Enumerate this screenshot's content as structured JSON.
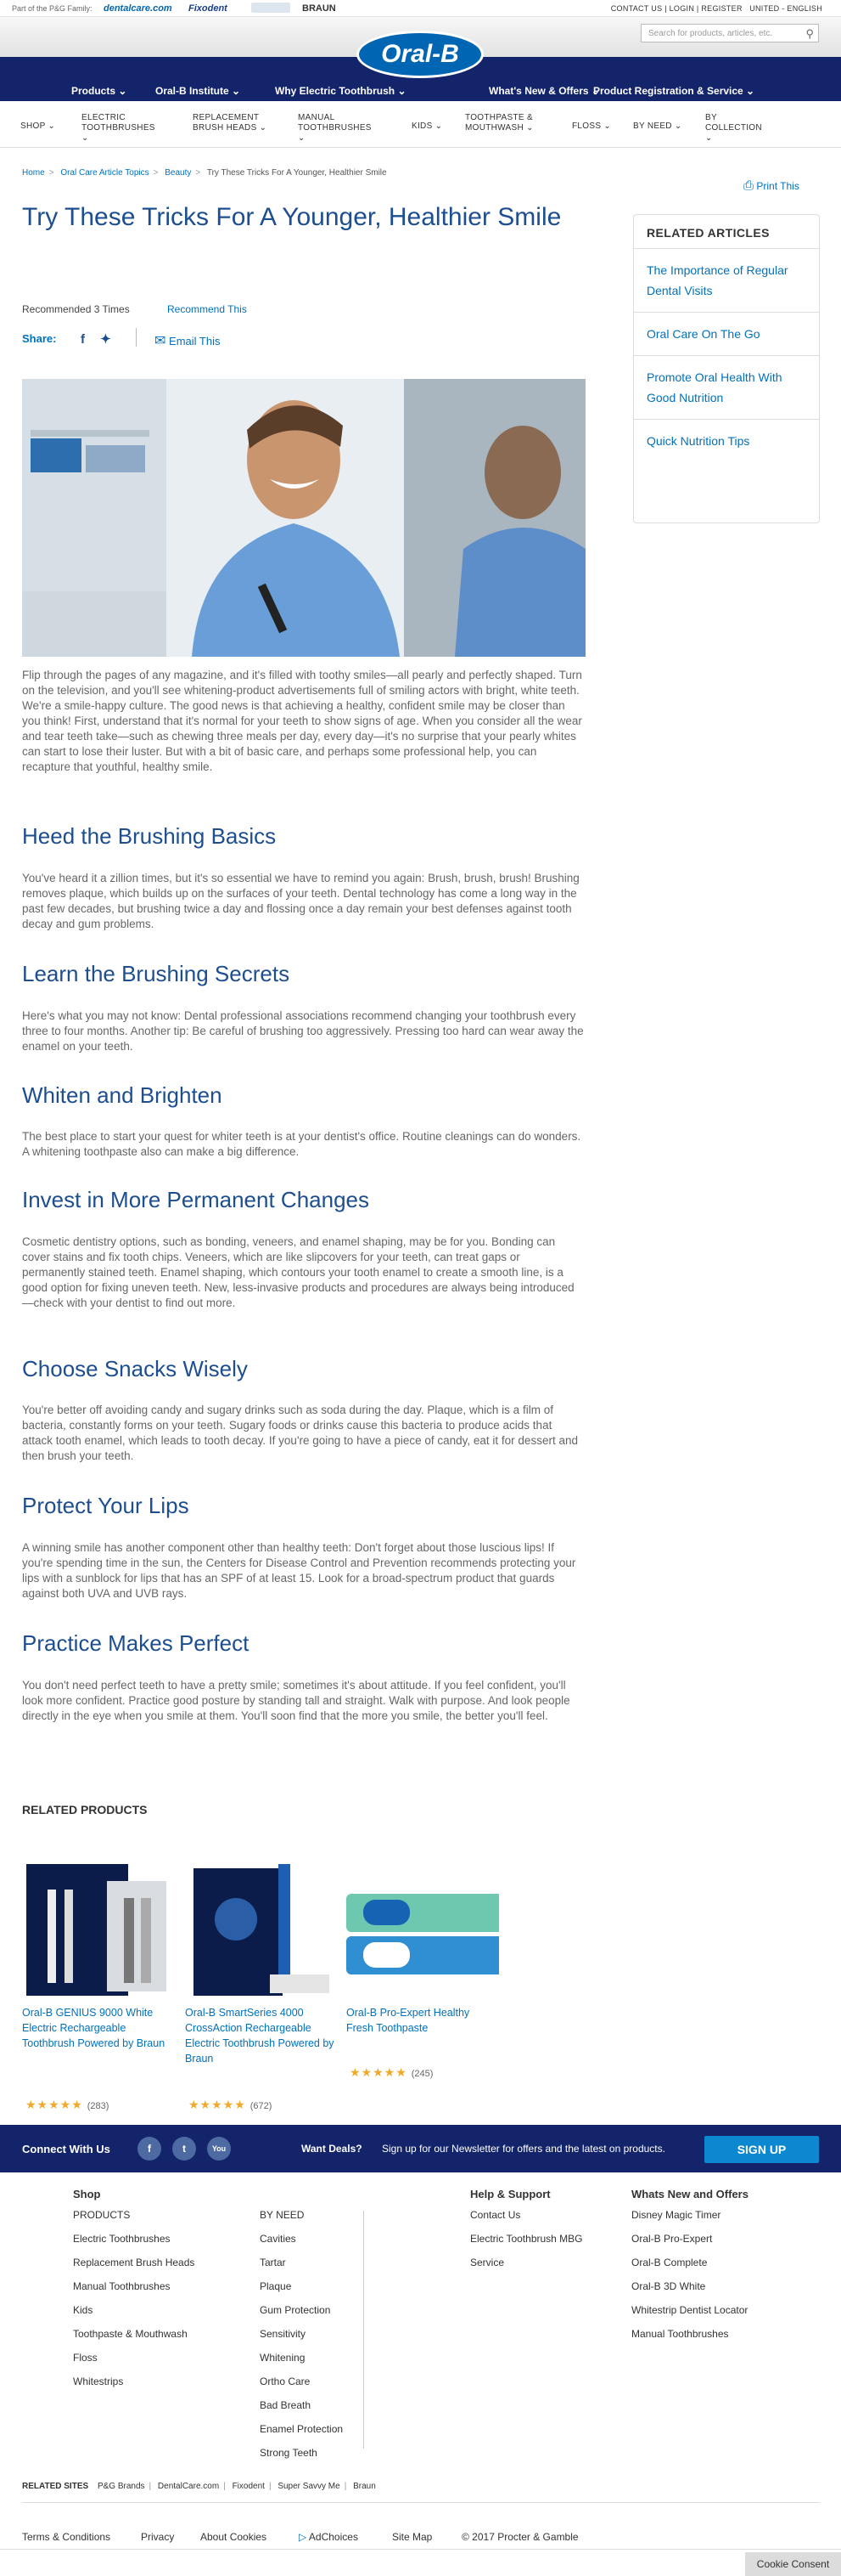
{
  "topbar": {
    "family_label": "Part of the P&G Family:",
    "brands": [
      "dentalcare.com",
      "Fixodent",
      "",
      "BRAUN"
    ],
    "links": "CONTACT US | LOGIN | REGISTER",
    "region": "UNITED - ENGLISH"
  },
  "search": {
    "placeholder": "Search for products, articles, etc."
  },
  "logo": {
    "text": "Oral-B"
  },
  "main_nav": [
    "Products",
    "Oral-B Institute",
    "Why Electric Toothbrush",
    "What's New & Offers",
    "Product Registration & Service"
  ],
  "sub_nav": [
    "SHOP",
    "ELECTRIC TOOTHBRUSHES",
    "REPLACEMENT BRUSH HEADS",
    "MANUAL TOOTHBRUSHES",
    "KIDS",
    "TOOTHPASTE & MOUTHWASH",
    "FLOSS",
    "BY NEED",
    "BY COLLECTION"
  ],
  "breadcrumb": [
    "Home",
    "Oral Care Article Topics",
    "Beauty",
    "Try These Tricks For A Younger, Healthier Smile"
  ],
  "print_label": "Print This",
  "title": "Try These Tricks For A Younger, Healthier Smile",
  "recommended": "Recommended 3 Times",
  "recommend_link": "Recommend This",
  "share_label": "Share:",
  "email_label": "Email This",
  "article": {
    "intro": "Flip through the pages of any magazine, and it's filled with toothy smiles—all pearly and perfectly shaped. Turn on the television, and you'll see whitening-product advertisements full of smiling actors with bright, white teeth. We're a smile-happy culture. The good news is that achieving a healthy, confident smile may be closer than you think! First, understand that it's normal for your teeth to show signs of age. When you consider all the wear and tear teeth take—such as chewing three meals per day, every day—it's no surprise that your pearly whites can start to lose their luster. But with a bit of basic care, and perhaps some professional help, you can recapture that youthful, healthy smile.",
    "sections": [
      {
        "heading": "Heed the Brushing Basics",
        "body": "You've heard it a zillion times, but it's so essential we have to remind you again: Brush, brush, brush! Brushing removes plaque, which builds up on the surfaces of your teeth. Dental technology has come a long way in the past few decades, but brushing twice a day and flossing once a day remain your best defenses against tooth decay and gum problems."
      },
      {
        "heading": "Learn the Brushing Secrets",
        "body": "Here's what you may not know: Dental professional associations recommend changing your toothbrush every three to four months. Another tip: Be careful of brushing too aggressively. Pressing too hard can wear away the enamel on your teeth."
      },
      {
        "heading": "Whiten and Brighten",
        "body": "The best place to start your quest for whiter teeth is at your dentist's office. Routine cleanings can do wonders. A whitening toothpaste also can make a big difference."
      },
      {
        "heading": "Invest in More Permanent Changes",
        "body": "Cosmetic dentistry options, such as bonding, veneers, and enamel shaping, may be for you. Bonding can cover stains and fix tooth chips. Veneers, which are like slipcovers for your teeth, can treat gaps or permanently stained teeth. Enamel shaping, which contours your tooth enamel to create a smooth line, is a good option for fixing uneven teeth. New, less-invasive products and procedures are always being introduced—check with your dentist to find out more."
      },
      {
        "heading": "Choose Snacks Wisely",
        "body": "You're better off avoiding candy and sugary drinks such as soda during the day. Plaque, which is a film of bacteria, constantly forms on your teeth. Sugary foods or drinks cause this bacteria to produce acids that attack tooth enamel, which leads to tooth decay. If you're going to have a piece of candy, eat it for dessert and then brush your teeth."
      },
      {
        "heading": "Protect Your Lips",
        "body": "A winning smile has another component other than healthy teeth: Don't forget about those luscious lips! If you're spending time in the sun, the Centers for Disease Control and Prevention recommends protecting your lips with a sunblock for lips that has an SPF of at least 15. Look for a broad-spectrum product that guards against both UVA and UVB rays."
      },
      {
        "heading": "Practice Makes Perfect",
        "body": "You don't need perfect teeth to have a pretty smile; sometimes it's about attitude. If you feel confident, you'll look more confident. Practice good posture by standing tall and straight. Walk with purpose. And look people directly in the eye when you smile at them. You'll soon find that the more you smile, the better you'll feel."
      }
    ]
  },
  "sidebar": {
    "heading": "RELATED ARTICLES",
    "items": [
      "The Importance of Regular Dental Visits",
      "Oral Care On The Go",
      "Promote Oral Health With Good Nutrition",
      "Quick Nutrition Tips"
    ]
  },
  "related_products": {
    "heading": "RELATED PRODUCTS",
    "items": [
      {
        "name": "Oral-B GENIUS 9000 White Electric Rechargeable Toothbrush Powered by Braun",
        "rating": 5,
        "count": "(283)"
      },
      {
        "name": "Oral-B SmartSeries 4000 CrossAction Rechargeable Electric Toothbrush Powered by Braun",
        "rating": 5,
        "count": "(672)"
      },
      {
        "name": "Oral-B Pro-Expert Healthy Fresh Toothpaste",
        "rating": 5,
        "count": "(245)"
      }
    ]
  },
  "connect": {
    "label": "Connect With Us",
    "social": [
      "f",
      "t",
      "You"
    ],
    "deals": "Want Deals?",
    "newsletter": "Sign up for our Newsletter for offers and the latest on products.",
    "signup": "SIGN UP"
  },
  "footer": {
    "shop": {
      "heading": "Shop",
      "items": [
        "PRODUCTS",
        "Electric Toothbrushes",
        "Replacement Brush Heads",
        "Manual Toothbrushes",
        "Kids",
        "Toothpaste & Mouthwash",
        "Floss",
        "Whitestrips"
      ]
    },
    "byneed": {
      "heading": "",
      "items": [
        "BY NEED",
        "Cavities",
        "Tartar",
        "Plaque",
        "Gum Protection",
        "Sensitivity",
        "Whitening",
        "Ortho Care",
        "Bad Breath",
        "Enamel Protection",
        "Strong Teeth"
      ]
    },
    "help": {
      "heading": "Help & Support",
      "items": [
        "Contact Us",
        "Electric Toothbrush MBG",
        "Service"
      ]
    },
    "whatsnew": {
      "heading": "Whats New and Offers",
      "items": [
        "Disney Magic Timer",
        "Oral-B Pro-Expert",
        "Oral-B Complete",
        "Oral-B 3D White",
        "Whitestrip Dentist Locator",
        "Manual Toothbrushes"
      ]
    },
    "related_sites_label": "RELATED SITES",
    "related_sites": [
      "P&G Brands",
      "DentalCare.com",
      "Fixodent",
      "Super Savvy Me",
      "Braun"
    ],
    "bottom": [
      "Terms & Conditions",
      "Privacy",
      "About Cookies",
      "AdChoices",
      "Site Map",
      "© 2017 Procter & Gamble"
    ],
    "cookie": "Cookie Consent"
  }
}
